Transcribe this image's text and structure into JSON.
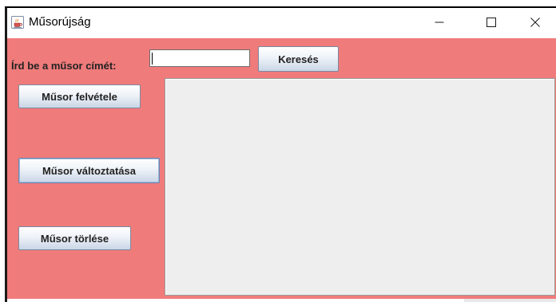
{
  "window": {
    "title": "Műsorújság",
    "icon": "java-cup-icon",
    "controls": {
      "minimize": "minimize-icon",
      "maximize": "maximize-icon",
      "close": "close-icon"
    }
  },
  "search": {
    "label": "Írd be a műsor címét:",
    "value": "",
    "placeholder": "",
    "button_label": "Keresés"
  },
  "actions": {
    "add_label": "Műsor felvétele",
    "edit_label": "Műsor változtatása",
    "delete_label": "Műsor törlése"
  },
  "list": {
    "items": []
  },
  "colors": {
    "content_background": "#f07b7b",
    "list_background": "#eeeeee",
    "titlebar_background": "#ffffff"
  }
}
